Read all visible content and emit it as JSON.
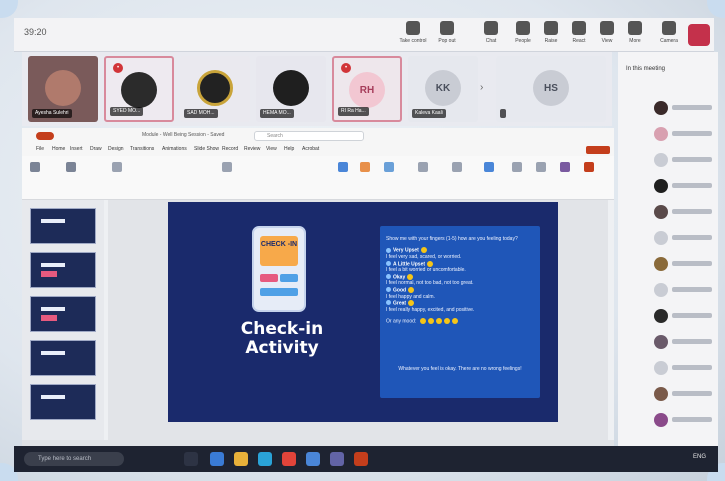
{
  "teams": {
    "meeting_time": "39:20",
    "toolbar": [
      {
        "label": "Take control",
        "icon": "take-control-icon"
      },
      {
        "label": "Pop out",
        "icon": "pop-out-icon"
      },
      {
        "label": "Chat",
        "icon": "chat-icon"
      },
      {
        "label": "People",
        "icon": "people-icon"
      },
      {
        "label": "Raise",
        "icon": "raise-hand-icon"
      },
      {
        "label": "React",
        "icon": "react-icon"
      },
      {
        "label": "View",
        "icon": "view-icon"
      },
      {
        "label": "More",
        "icon": "more-icon"
      },
      {
        "label": "Camera",
        "icon": "camera-icon"
      },
      {
        "label": "Mic",
        "icon": "mic-icon"
      }
    ],
    "participants": [
      {
        "name": "Ayesha Sulehri",
        "initials": ""
      },
      {
        "name": "SYED MO...",
        "initials": ""
      },
      {
        "name": "SAD MOH...",
        "initials": ""
      },
      {
        "name": "HEMA MO...",
        "initials": ""
      },
      {
        "name": "RI Ra Ha...",
        "initials": "RH"
      },
      {
        "name": "Kaleva Kaali",
        "initials": "KK"
      },
      {
        "name": "",
        "initials": "HS"
      }
    ],
    "people_header": "In this meeting"
  },
  "powerpoint": {
    "autosave": "AutoSave",
    "file_name": "Module - Well Being Session - Saved",
    "search_placeholder": "Search",
    "menu": [
      "File",
      "Home",
      "Insert",
      "Draw",
      "Design",
      "Transitions",
      "Animations",
      "Slide Show",
      "Record",
      "Review",
      "View",
      "Help",
      "Acrobat"
    ]
  },
  "slide": {
    "phone_label": "CHECK -IN",
    "title": "Check-in Activity",
    "prompt": "Show me with your fingers (1-5) how are you feeling today?",
    "levels": [
      {
        "label": "Very Upset",
        "desc": "I feel very sad, scared, or worried."
      },
      {
        "label": "A Little Upset",
        "desc": "I feel a bit worried or uncomfortable."
      },
      {
        "label": "Okay",
        "desc": "I feel normal, not too bad, not too great."
      },
      {
        "label": "Good",
        "desc": "I feel happy and calm."
      },
      {
        "label": "Great",
        "desc": "I feel really happy, excited, and positive."
      }
    ],
    "your_mood": "Or any mood:",
    "footer": "Whatever you feel is okay. There are no wrong feelings!"
  },
  "taskbar": {
    "search_placeholder": "Type here to search",
    "tray_text": "ENG"
  },
  "colors": {
    "slide_bg": "#1a2a6c",
    "card_bg": "#1f56b8",
    "accent_orange": "#f7a94a",
    "ppt_red": "#c43e1c"
  }
}
